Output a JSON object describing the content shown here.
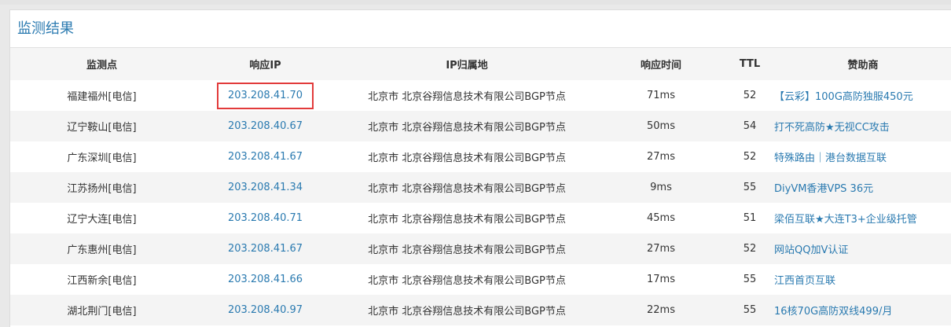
{
  "panel": {
    "title": "监测结果"
  },
  "table": {
    "headers": [
      "监测点",
      "响应IP",
      "IP归属地",
      "响应时间",
      "TTL",
      "赞助商"
    ],
    "rows": [
      {
        "location": "福建福州[电信]",
        "ip": "203.208.41.70",
        "geo": "北京市 北京谷翔信息技术有限公司BGP节点",
        "time": "71ms",
        "ttl": "52",
        "sponsor": "【云彩】100G高防独服450元"
      },
      {
        "location": "辽宁鞍山[电信]",
        "ip": "203.208.40.67",
        "geo": "北京市 北京谷翔信息技术有限公司BGP节点",
        "time": "50ms",
        "ttl": "54",
        "sponsor": "打不死高防★无视CC攻击"
      },
      {
        "location": "广东深圳[电信]",
        "ip": "203.208.41.67",
        "geo": "北京市 北京谷翔信息技术有限公司BGP节点",
        "time": "27ms",
        "ttl": "52",
        "sponsor": "特殊路由｜港台数据互联"
      },
      {
        "location": "江苏扬州[电信]",
        "ip": "203.208.41.34",
        "geo": "北京市 北京谷翔信息技术有限公司BGP节点",
        "time": "9ms",
        "ttl": "55",
        "sponsor": "DiyVM香港VPS 36元"
      },
      {
        "location": "辽宁大连[电信]",
        "ip": "203.208.40.71",
        "geo": "北京市 北京谷翔信息技术有限公司BGP节点",
        "time": "45ms",
        "ttl": "51",
        "sponsor": "梁佰互联★大连T3+企业级托管"
      },
      {
        "location": "广东惠州[电信]",
        "ip": "203.208.41.67",
        "geo": "北京市 北京谷翔信息技术有限公司BGP节点",
        "time": "27ms",
        "ttl": "52",
        "sponsor": "网站QQ加V认证"
      },
      {
        "location": "江西新余[电信]",
        "ip": "203.208.41.66",
        "geo": "北京市 北京谷翔信息技术有限公司BGP节点",
        "time": "17ms",
        "ttl": "55",
        "sponsor": "江西首页互联"
      },
      {
        "location": "湖北荆门[电信]",
        "ip": "203.208.40.97",
        "geo": "北京市 北京谷翔信息技术有限公司BGP节点",
        "time": "22ms",
        "ttl": "55",
        "sponsor": "16核70G高防双线499/月"
      }
    ]
  },
  "colors": {
    "link": "#2a7ab0",
    "highlight_border": "#e23b3b",
    "row_alt": "#f4f4f4"
  }
}
